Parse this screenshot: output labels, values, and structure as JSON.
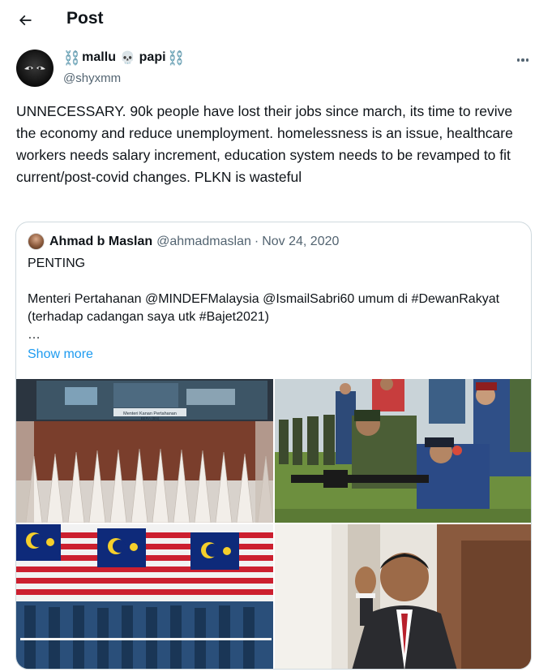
{
  "header": {
    "title": "Post"
  },
  "post": {
    "author_name": "mallu",
    "author_name_2": "papi",
    "name_emoji_chain": "⛓️",
    "name_emoji_skull": "💀",
    "handle": "@shyxmm",
    "text": "UNNECESSARY. 90k people have lost their jobs since march, its time to revive the economy and reduce unemployment. homelessness is an issue, healthcare workers needs salary increment, education system needs to be revamped to fit current/post-covid changes. PLKN is wasteful"
  },
  "quote": {
    "author_name": "Ahmad b Maslan",
    "handle": "@ahmadmaslan",
    "separator": "·",
    "date": "Nov 24, 2020",
    "body": "PENTING\n\nMenteri Pertahanan @MINDEFMalaysia @IsmailSabri60 umum di #DewanRakyat (terhadap cadangan saya utk #Bajet2021)\n…",
    "show_more": "Show more",
    "media": [
      {
        "name": "parliament-photo",
        "caption": "Menteri Kanan Pertahanan\nBERA (BN)"
      },
      {
        "name": "cadets-rifle-photo"
      },
      {
        "name": "flag-parade-photo"
      },
      {
        "name": "politician-waving-photo"
      }
    ]
  },
  "icons": {
    "back": "arrow-left-icon",
    "more": "more-horizontal-icon"
  },
  "colors": {
    "text": "#0f1419",
    "secondary": "#536471",
    "link": "#1d9bf0",
    "border": "#cfd9de"
  }
}
